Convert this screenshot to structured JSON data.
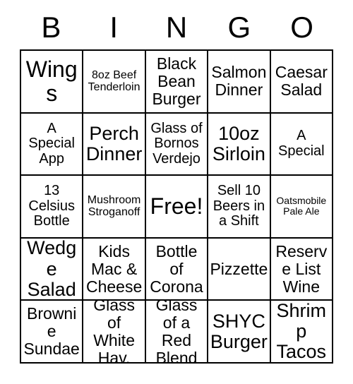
{
  "card": {
    "header_letters": [
      "B",
      "I",
      "N",
      "G",
      "O"
    ],
    "free_space_index": 12,
    "colors": {
      "border": "#000000",
      "background": "#ffffff",
      "text": "#000000"
    },
    "cells": [
      {
        "text": "Wings",
        "size": "fs-xxl"
      },
      {
        "text": "8oz Beef Tenderloin",
        "size": "fs-s"
      },
      {
        "text": "Black Bean Burger",
        "size": "fs-l"
      },
      {
        "text": "Salmon Dinner",
        "size": "fs-l"
      },
      {
        "text": "Caesar Salad",
        "size": "fs-l"
      },
      {
        "text": "A Special App",
        "size": "fs-m"
      },
      {
        "text": "Perch Dinner",
        "size": "fs-xl"
      },
      {
        "text": "Glass of Bornos Verdejo",
        "size": "fs-m"
      },
      {
        "text": "10oz Sirloin",
        "size": "fs-xl"
      },
      {
        "text": "A Special",
        "size": "fs-m"
      },
      {
        "text": "13 Celsius Bottle",
        "size": "fs-m"
      },
      {
        "text": "Mushroom Stroganoff",
        "size": "fs-s"
      },
      {
        "text": "Free!",
        "size": "fs-xxl"
      },
      {
        "text": "Sell 10 Beers in a Shift",
        "size": "fs-m"
      },
      {
        "text": "Oatsmobile Pale Ale",
        "size": "fs-xs"
      },
      {
        "text": "Wedge Salad",
        "size": "fs-xl"
      },
      {
        "text": "Kids Mac & Cheese",
        "size": "fs-l"
      },
      {
        "text": "Bottle of Corona",
        "size": "fs-l"
      },
      {
        "text": "Pizzette",
        "size": "fs-l"
      },
      {
        "text": "Reserve List Wine",
        "size": "fs-l"
      },
      {
        "text": "Brownie Sundae",
        "size": "fs-l"
      },
      {
        "text": "Glass of White Hav.",
        "size": "fs-l"
      },
      {
        "text": "Glass of a Red Blend",
        "size": "fs-l"
      },
      {
        "text": "SHYC Burger",
        "size": "fs-xl"
      },
      {
        "text": "Shrimp Tacos",
        "size": "fs-xl"
      }
    ]
  }
}
